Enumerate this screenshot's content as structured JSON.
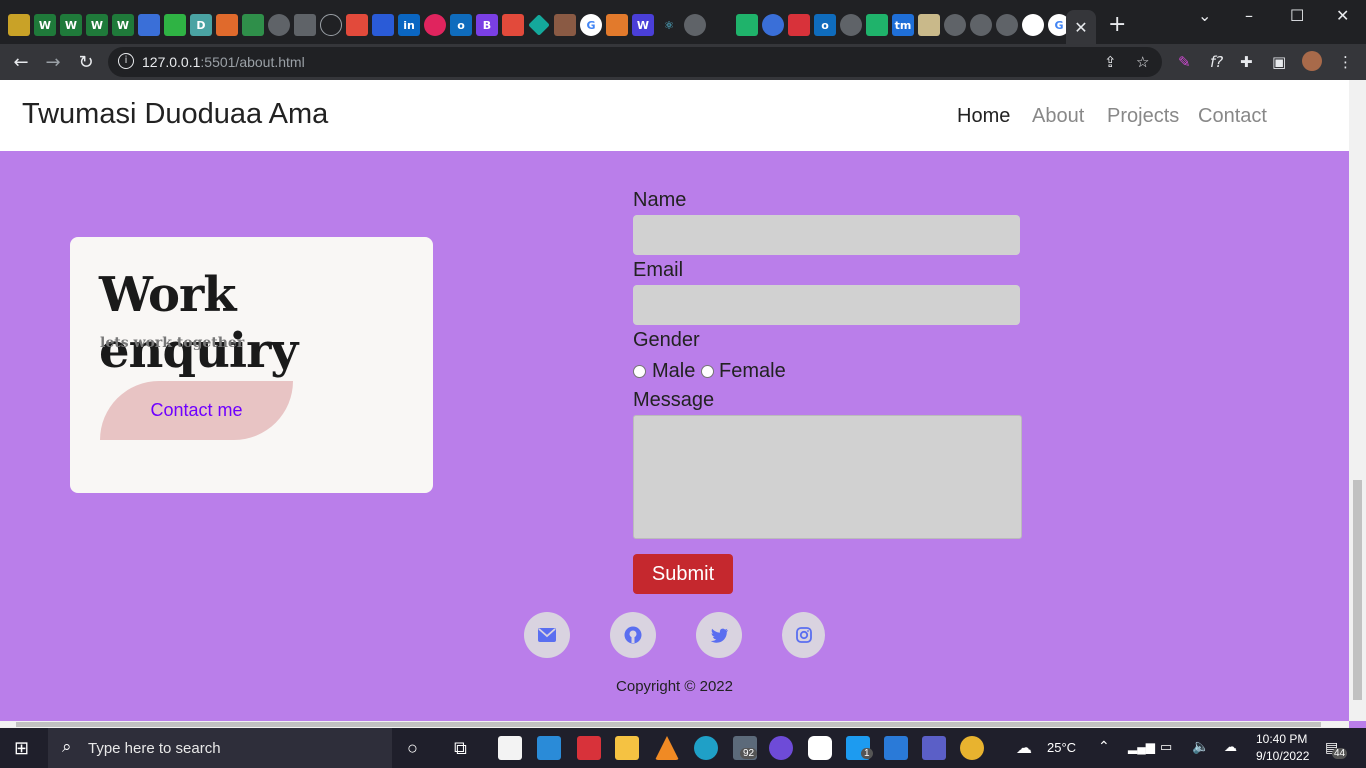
{
  "browser": {
    "active_tab_close": "✕",
    "new_tab": "+",
    "url_host": "127.0.0.1",
    "url_rest": ":5501/about.html"
  },
  "navbar": {
    "brand": "Twumasi Duoduaa Ama",
    "links": [
      {
        "label": "Home"
      },
      {
        "label": "About"
      },
      {
        "label": "Projects"
      },
      {
        "label": "Contact"
      }
    ]
  },
  "card": {
    "title": "Work enquiry",
    "subtitle": "lets work together",
    "button": "Contact me"
  },
  "form": {
    "name_label": "Name",
    "email_label": "Email",
    "gender_label": "Gender",
    "male_label": "Male",
    "female_label": "Female",
    "message_label": "Message",
    "submit_label": "Submit"
  },
  "socials": [
    "envelope-icon",
    "github-icon",
    "twitter-icon",
    "instagram-icon"
  ],
  "footer": {
    "copyright": "Copyright © 2022"
  },
  "taskbar": {
    "search_placeholder": "Type here to search",
    "temperature": "25°C",
    "time": "10:40 PM",
    "date": "9/10/2022",
    "mail_badge": "92",
    "twitter_badge": "1",
    "notifications": "44"
  },
  "colors": {
    "page_bg": "#ba7eea",
    "card_bg": "#f9f7f5",
    "contact_button": "#e8c4c4",
    "contact_text": "#6f00ff",
    "submit": "#c5282e",
    "field_bg": "#d1d1d1",
    "social_icon": "#5a6ef0"
  }
}
